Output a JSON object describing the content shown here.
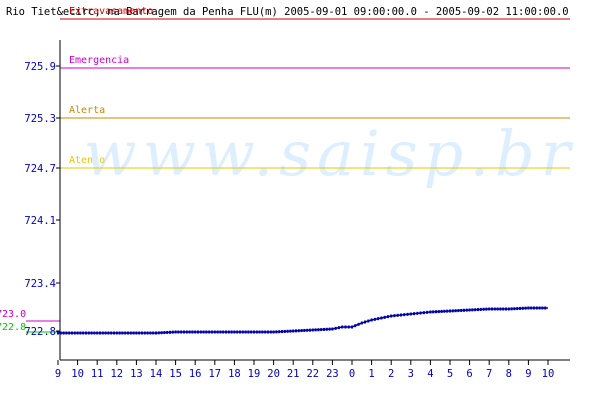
{
  "chart_data": {
    "type": "line",
    "title": "Rio Tiet&ecirc; na Barragem da Penha FLU(m) 2005-09-01 09:00:00.0 - 2005-09-02 11:00:00.0",
    "watermark": "www.saisp.br",
    "xlabel": "",
    "ylabel": "",
    "x_ticks": [
      "9",
      "10",
      "11",
      "12",
      "13",
      "14",
      "15",
      "16",
      "17",
      "18",
      "19",
      "20",
      "21",
      "22",
      "23",
      "0",
      "1",
      "2",
      "3",
      "4",
      "5",
      "6",
      "7",
      "8",
      "9",
      "10"
    ],
    "y_ticks": [
      "725.9",
      "725.3",
      "724.7",
      "724.1",
      "723.4",
      "722.8"
    ],
    "ylim": [
      722.6,
      726.1
    ],
    "thresholds": [
      {
        "label": "Extravasamento",
        "value": 725.97,
        "color": "#cc0000"
      },
      {
        "label": "Emergencia",
        "value": 725.48,
        "color": "#cc00cc"
      },
      {
        "label": "Alerta",
        "value": 724.98,
        "color": "#cc8800"
      },
      {
        "label": "Aten  o",
        "value": 724.48,
        "color": "#e8c800"
      }
    ],
    "side_labels": [
      {
        "label": "723.0",
        "value": 723.0,
        "color": "#cc00cc"
      },
      {
        "label": "722.8",
        "value": 722.84,
        "color": "#00cc00"
      }
    ],
    "series": [
      {
        "color": "#0000aa",
        "x": [
          0,
          1,
          2,
          3,
          4,
          5,
          6,
          7,
          8,
          9,
          10,
          11,
          12,
          13,
          14,
          14.5,
          15,
          15.5,
          16,
          16.5,
          17,
          17.5,
          18,
          18.5,
          19,
          20,
          21,
          22,
          23,
          24,
          25
        ],
        "y": [
          722.83,
          722.83,
          722.83,
          722.83,
          722.83,
          722.83,
          722.84,
          722.84,
          722.84,
          722.84,
          722.84,
          722.84,
          722.85,
          722.86,
          722.87,
          722.89,
          722.89,
          722.93,
          722.96,
          722.98,
          723.0,
          723.01,
          723.02,
          723.03,
          723.04,
          723.05,
          723.06,
          723.07,
          723.07,
          723.08,
          723.08
        ]
      }
    ]
  }
}
